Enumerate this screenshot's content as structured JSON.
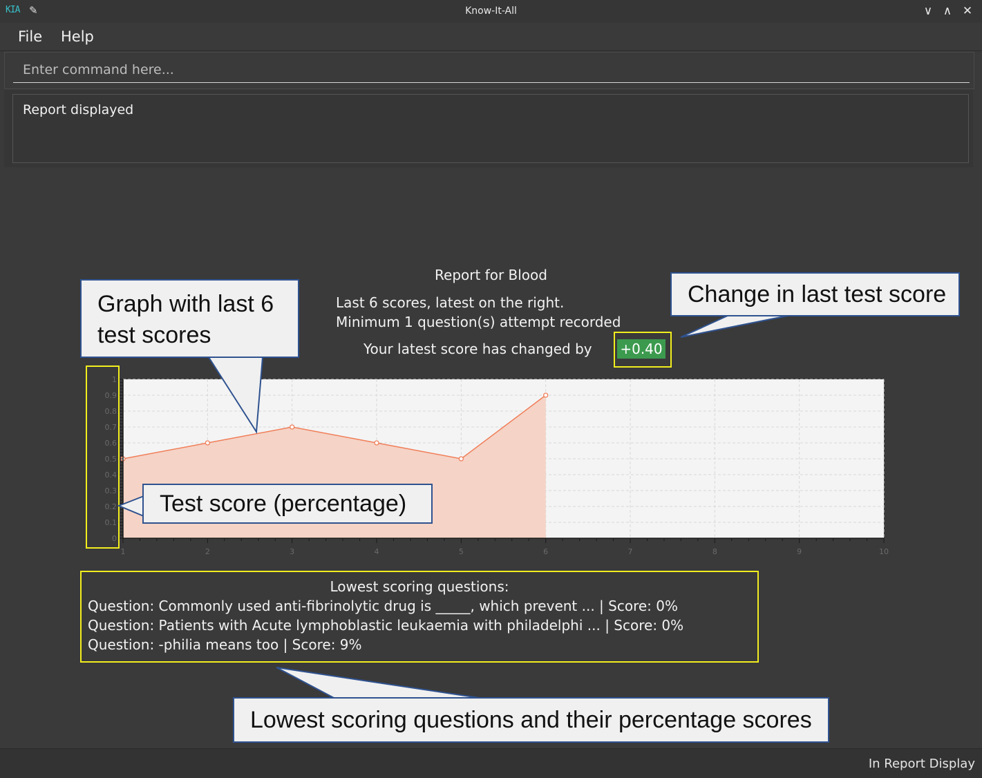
{
  "window": {
    "title": "Know-It-All",
    "logo": "KIA",
    "icons": [
      "app-logo-icon",
      "pin-icon",
      "minimize-icon",
      "maximize-icon",
      "close-icon"
    ],
    "controls": {
      "minimize": "∨",
      "maximize": "∧",
      "close": "✕"
    },
    "pin": "✎"
  },
  "menu": {
    "file": "File",
    "help": "Help"
  },
  "command": {
    "placeholder": "Enter command here..."
  },
  "result": {
    "text": "Report displayed"
  },
  "report": {
    "title": "Report for Blood",
    "line1": "Last 6 scores, latest on the right.",
    "line2": "Minimum 1 question(s) attempt recorded",
    "change_prefix": "Your latest score has changed by",
    "change_value": "+0.40"
  },
  "chart_data": {
    "type": "area",
    "x": [
      1,
      2,
      3,
      4,
      5,
      6
    ],
    "values": [
      0.5,
      0.6,
      0.7,
      0.6,
      0.5,
      0.9
    ],
    "xlim": [
      1,
      10
    ],
    "ylim": [
      0,
      1
    ],
    "x_ticks": [
      "1",
      "2",
      "3",
      "4",
      "5",
      "6",
      "7",
      "8",
      "9",
      "10"
    ],
    "y_ticks": [
      "0",
      "0.1",
      "0.2",
      "0.3",
      "0.4",
      "0.5",
      "0.6",
      "0.7",
      "0.8",
      "0.9",
      "1"
    ],
    "grid": true,
    "line_color": "#f07e59",
    "fill_color": "#f5d3c6"
  },
  "lowest": {
    "title": "Lowest scoring questions:",
    "items": [
      "Question: Commonly used anti-fibrinolytic drug is _____, which prevent ... | Score: 0%",
      "Question: Patients with Acute lymphoblastic leukaemia with philadelphi ... | Score: 0%",
      "Question: -philia means too | Score: 9%"
    ]
  },
  "callouts": {
    "graph": "Graph with last 6 test scores",
    "graph_line1": "Graph with last 6",
    "graph_line2": "test scores",
    "change": "Change in last test score",
    "score": "Test score (percentage)",
    "lowest": "Lowest scoring questions and their percentage scores"
  },
  "status": {
    "text": "In Report Display"
  },
  "colors": {
    "background": "#3a3a3a",
    "highlight": "#f2ee1e",
    "callout_border": "#2f528f",
    "positive": "#3c9a4e"
  }
}
